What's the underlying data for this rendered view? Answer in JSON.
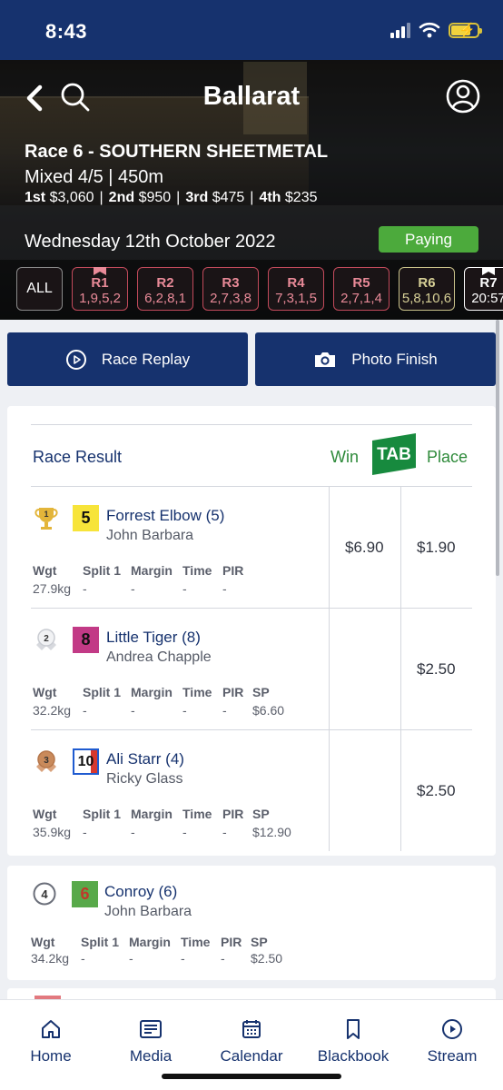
{
  "status": {
    "time": "8:43"
  },
  "header": {
    "title": "Ballarat",
    "race_name": "Race 6 - SOUTHERN SHEETMETAL",
    "race_class": "Mixed 4/5  |  450m",
    "prizes": [
      {
        "place": "1st",
        "amount": "$3,060"
      },
      {
        "place": "2nd",
        "amount": "$950"
      },
      {
        "place": "3rd",
        "amount": "$475"
      },
      {
        "place": "4th",
        "amount": "$235"
      }
    ],
    "date": "Wednesday 12th October 2022",
    "status_badge": "Paying"
  },
  "race_tabs": [
    {
      "label": "ALL"
    },
    {
      "label": "R1",
      "result": "1,9,5,2"
    },
    {
      "label": "R2",
      "result": "6,2,8,1"
    },
    {
      "label": "R3",
      "result": "2,7,3,8"
    },
    {
      "label": "R4",
      "result": "7,3,1,5"
    },
    {
      "label": "R5",
      "result": "2,7,1,4"
    },
    {
      "label": "R6",
      "result": "5,8,10,6"
    },
    {
      "label": "R7",
      "result": "20:57"
    }
  ],
  "actions": {
    "replay": "Race Replay",
    "photo": "Photo Finish"
  },
  "results": {
    "heading": "Race Result",
    "win_label": "Win",
    "tote_logo": "TAB",
    "place_label": "Place",
    "stat_labels": {
      "wgt": "Wgt",
      "split": "Split 1",
      "margin": "Margin",
      "time": "Time",
      "pir": "PIR",
      "sp": "SP"
    },
    "runners": [
      {
        "pos": "1",
        "box": "5",
        "name": "Forrest Elbow (5)",
        "trainer": "John Barbara",
        "wgt": "27.9kg",
        "split": "-",
        "margin": "-",
        "time": "-",
        "pir": "-",
        "sp": "",
        "win": "$6.90",
        "place": "$1.90"
      },
      {
        "pos": "2",
        "box": "8",
        "name": "Little Tiger (8)",
        "trainer": "Andrea Chapple",
        "wgt": "32.2kg",
        "split": "-",
        "margin": "-",
        "time": "-",
        "pir": "-",
        "sp": "$6.60",
        "win": "",
        "place": "$2.50"
      },
      {
        "pos": "3",
        "box": "10",
        "name": "Ali Starr (4)",
        "trainer": "Ricky Glass",
        "wgt": "35.9kg",
        "split": "-",
        "margin": "-",
        "time": "-",
        "pir": "-",
        "sp": "$12.90",
        "win": "",
        "place": "$2.50"
      },
      {
        "pos": "4",
        "box": "6",
        "name": "Conroy (6)",
        "trainer": "John Barbara",
        "wgt": "34.2kg",
        "split": "-",
        "margin": "-",
        "time": "-",
        "pir": "-",
        "sp": "$2.50"
      }
    ]
  },
  "nav": [
    {
      "label": "Home",
      "icon": "home-icon"
    },
    {
      "label": "Media",
      "icon": "media-icon"
    },
    {
      "label": "Calendar",
      "icon": "calendar-icon"
    },
    {
      "label": "Blackbook",
      "icon": "bookmark-icon"
    },
    {
      "label": "Stream",
      "icon": "play-icon"
    }
  ]
}
